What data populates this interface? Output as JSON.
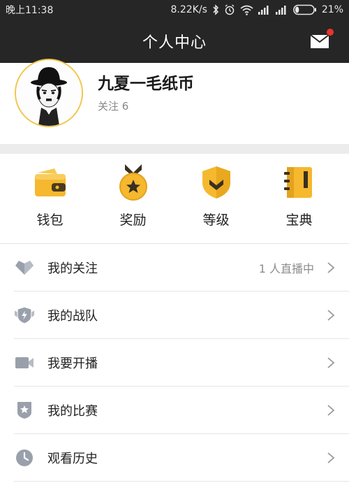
{
  "status_bar": {
    "time": "晚上11:38",
    "speed": "8.22K/s",
    "battery": "21%",
    "battery_level": 0.21
  },
  "header": {
    "title": "个人中心"
  },
  "profile": {
    "username": "九夏一毛纸币",
    "follow_text": "关注 6"
  },
  "quick_actions": [
    {
      "label": "钱包",
      "icon": "wallet-icon"
    },
    {
      "label": "奖励",
      "icon": "medal-icon"
    },
    {
      "label": "等级",
      "icon": "level-shield-icon"
    },
    {
      "label": "宝典",
      "icon": "book-icon"
    }
  ],
  "menu": [
    {
      "label": "我的关注",
      "extra": "1 人直播中",
      "icon": "heart-icon"
    },
    {
      "label": "我的战队",
      "extra": "",
      "icon": "team-icon"
    },
    {
      "label": "我要开播",
      "extra": "",
      "icon": "camera-icon"
    },
    {
      "label": "我的比赛",
      "extra": "",
      "icon": "match-badge-icon"
    },
    {
      "label": "观看历史",
      "extra": "",
      "icon": "clock-icon"
    }
  ],
  "colors": {
    "header_bg": "#262626",
    "accent_gold": "#f5b82e",
    "divider": "#ececec",
    "notification_dot": "#e8352b"
  }
}
